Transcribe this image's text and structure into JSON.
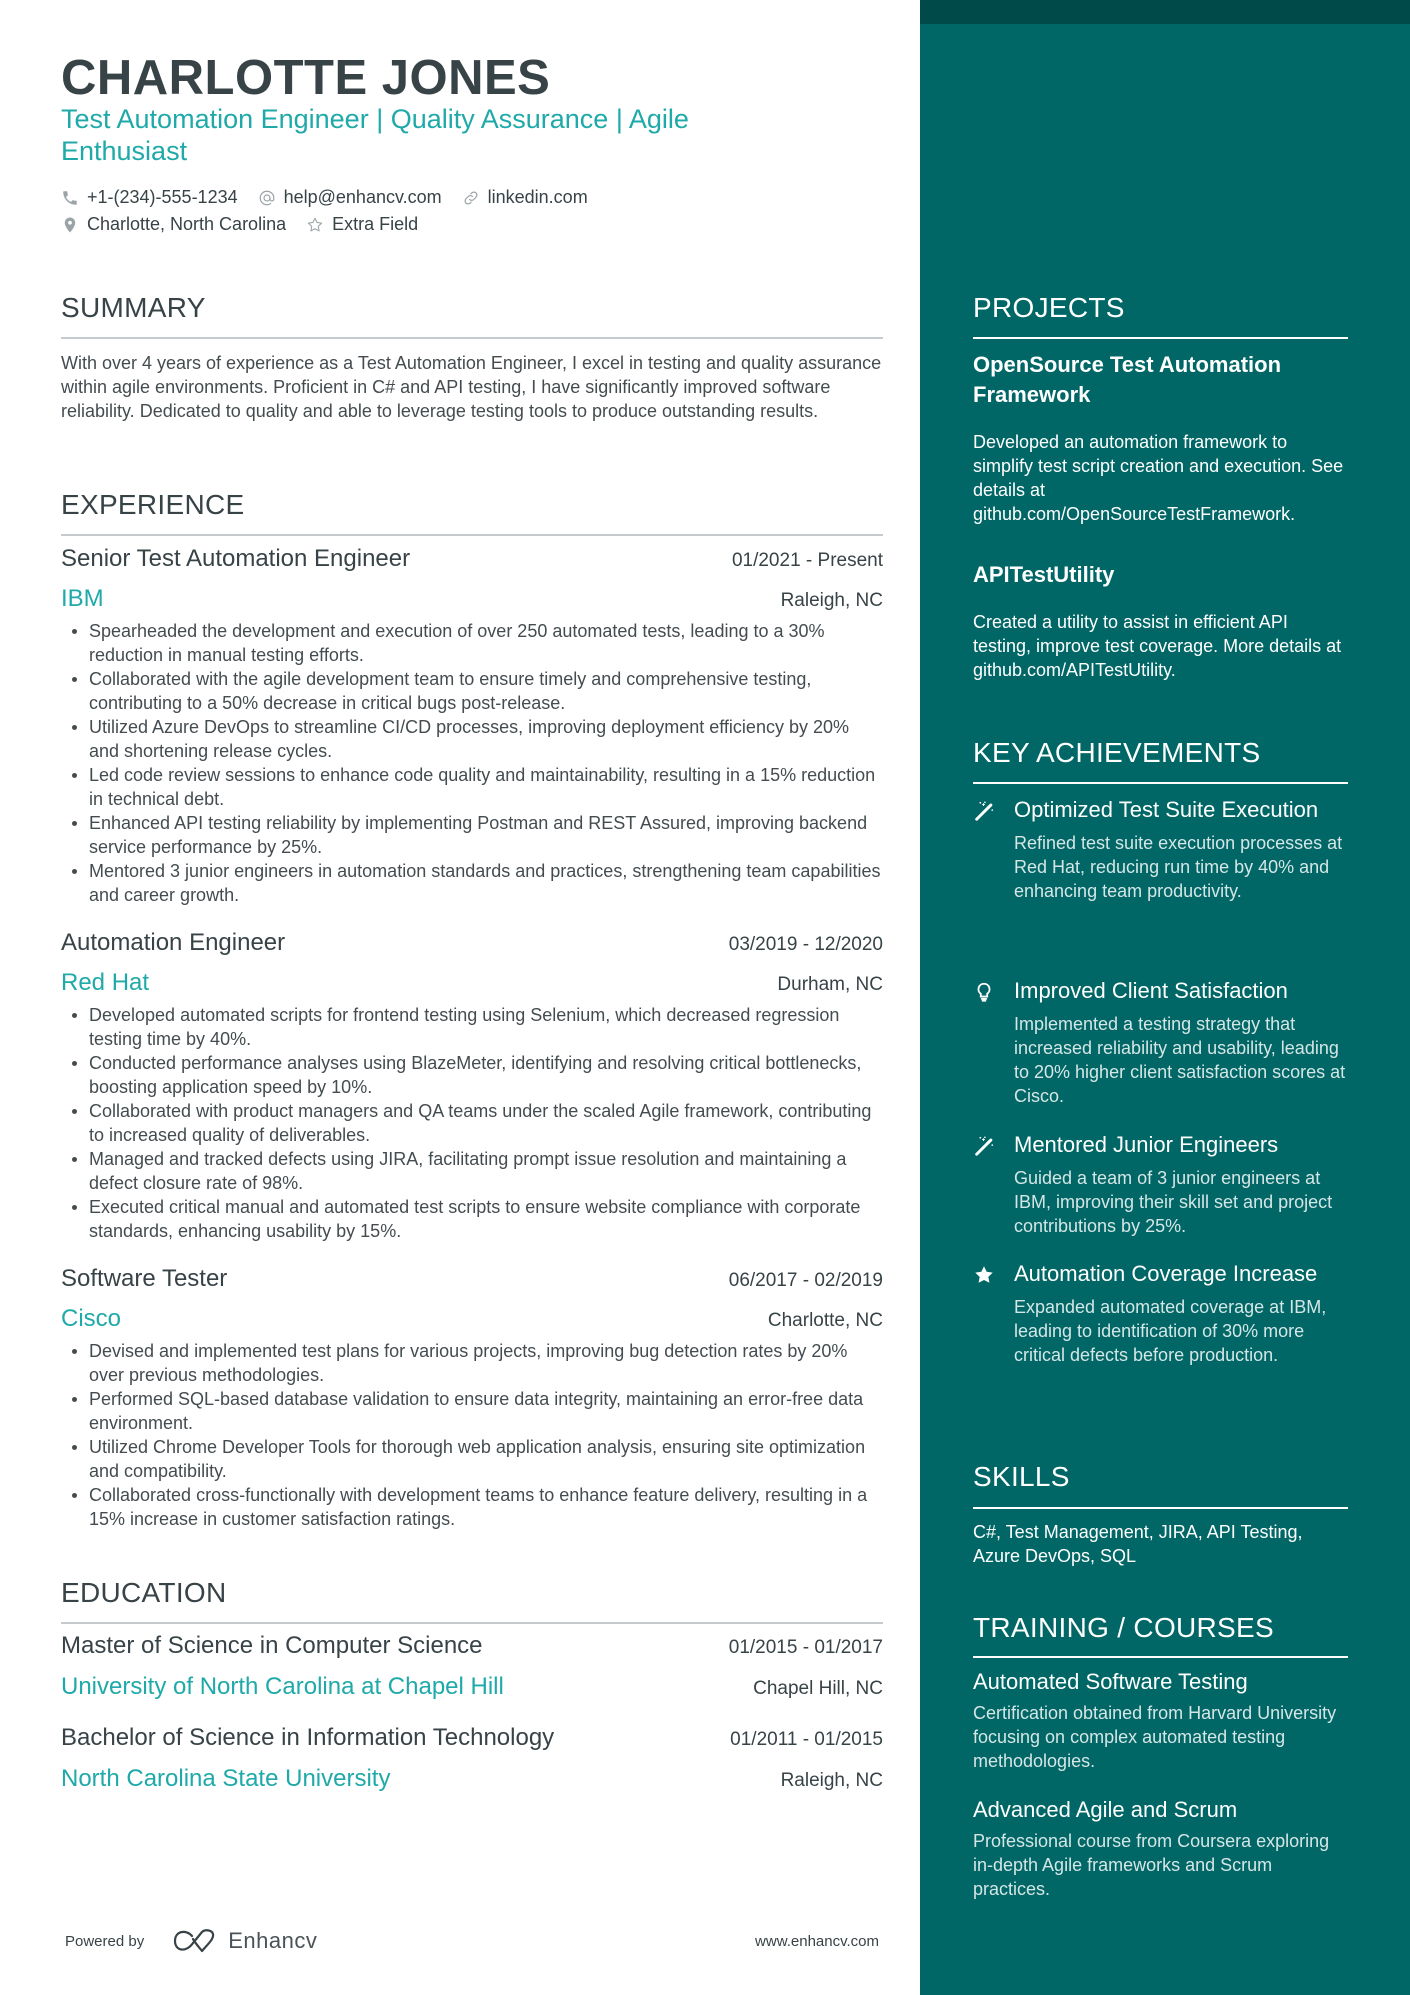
{
  "header": {
    "name": "CHARLOTTE JONES",
    "subtitle": "Test Automation Engineer | Quality Assurance | Agile Enthusiast",
    "contacts": [
      {
        "icon": "phone-icon",
        "text": "+1-(234)-555-1234"
      },
      {
        "icon": "at-icon",
        "text": "help@enhancv.com"
      },
      {
        "icon": "link-icon",
        "text": "linkedin.com"
      },
      {
        "icon": "location-pin-icon",
        "text": "Charlotte, North Carolina"
      },
      {
        "icon": "star-outline-icon",
        "text": "Extra Field"
      }
    ]
  },
  "summary": {
    "title": "SUMMARY",
    "text": "With over 4 years of experience as a Test Automation Engineer, I excel in testing and quality assurance within agile environments. Proficient in C# and API testing, I have significantly improved software reliability. Dedicated to quality and able to leverage testing tools to produce outstanding results."
  },
  "experience": {
    "title": "EXPERIENCE",
    "jobs": [
      {
        "title": "Senior Test Automation Engineer",
        "dates": "01/2021 - Present",
        "company": "IBM",
        "location": "Raleigh, NC",
        "bullets": [
          "Spearheaded the development and execution of over 250 automated tests, leading to a 30% reduction in manual testing efforts.",
          "Collaborated with the agile development team to ensure timely and comprehensive testing, contributing to a 50% decrease in critical bugs post-release.",
          "Utilized Azure DevOps to streamline CI/CD processes, improving deployment efficiency by 20% and shortening release cycles.",
          "Led code review sessions to enhance code quality and maintainability, resulting in a 15% reduction in technical debt.",
          "Enhanced API testing reliability by implementing Postman and REST Assured, improving backend service performance by 25%.",
          "Mentored 3 junior engineers in automation standards and practices, strengthening team capabilities and career growth."
        ]
      },
      {
        "title": "Automation Engineer",
        "dates": "03/2019 - 12/2020",
        "company": "Red Hat",
        "location": "Durham, NC",
        "bullets": [
          "Developed automated scripts for frontend testing using Selenium, which decreased regression testing time by 40%.",
          "Conducted performance analyses using BlazeMeter, identifying and resolving critical bottlenecks, boosting application speed by 10%.",
          "Collaborated with product managers and QA teams under the scaled Agile framework, contributing to increased quality of deliverables.",
          "Managed and tracked defects using JIRA, facilitating prompt issue resolution and maintaining a defect closure rate of 98%.",
          "Executed critical manual and automated test scripts to ensure website compliance with corporate standards, enhancing usability by 15%."
        ]
      },
      {
        "title": "Software Tester",
        "dates": "06/2017 - 02/2019",
        "company": "Cisco",
        "location": "Charlotte, NC",
        "bullets": [
          "Devised and implemented test plans for various projects, improving bug detection rates by 20% over previous methodologies.",
          "Performed SQL-based database validation to ensure data integrity, maintaining an error-free data environment.",
          "Utilized Chrome Developer Tools for thorough web application analysis, ensuring site optimization and compatibility.",
          "Collaborated cross-functionally with development teams to enhance feature delivery, resulting in a 15% increase in customer satisfaction ratings."
        ]
      }
    ]
  },
  "education": {
    "title": "EDUCATION",
    "items": [
      {
        "degree": "Master of Science in Computer Science",
        "dates": "01/2015 - 01/2017",
        "school": "University of North Carolina at Chapel Hill",
        "location": "Chapel Hill, NC"
      },
      {
        "degree": "Bachelor of Science in Information Technology",
        "dates": "01/2011 - 01/2015",
        "school": "North Carolina State University",
        "location": "Raleigh, NC"
      }
    ]
  },
  "footer": {
    "powered_by": "Powered by",
    "brand": "Enhancv",
    "website": "www.enhancv.com"
  },
  "sidebar": {
    "projects": {
      "title": "PROJECTS",
      "items": [
        {
          "title": "OpenSource Test Automation Framework",
          "description": "Developed an automation framework to simplify test script creation and execution. See details at github.com/OpenSourceTestFramework."
        },
        {
          "title": "APITestUtility",
          "description": "Created a utility to assist in efficient API testing, improve test coverage. More details at github.com/APITestUtility."
        }
      ]
    },
    "achievements": {
      "title": "KEY ACHIEVEMENTS",
      "items": [
        {
          "icon": "magic-wand-icon",
          "title": "Optimized Test Suite Execution",
          "description": "Refined test suite execution processes at Red Hat, reducing run time by 40% and enhancing team productivity."
        },
        {
          "icon": "lightbulb-icon",
          "title": "Improved Client Satisfaction",
          "description": "Implemented a testing strategy that increased reliability and usability, leading to 20% higher client satisfaction scores at Cisco."
        },
        {
          "icon": "magic-wand-icon",
          "title": "Mentored Junior Engineers",
          "description": "Guided a team of 3 junior engineers at IBM, improving their skill set and project contributions by 25%."
        },
        {
          "icon": "star-icon",
          "title": "Automation Coverage Increase",
          "description": "Expanded automated coverage at IBM, leading to identification of 30% more critical defects before production."
        }
      ]
    },
    "skills": {
      "title": "SKILLS",
      "text": "C#, Test Management, JIRA, API Testing, Azure DevOps, SQL"
    },
    "training": {
      "title": "TRAINING / COURSES",
      "items": [
        {
          "title": "Automated Software Testing",
          "description": "Certification obtained from Harvard University focusing on complex automated testing methodologies."
        },
        {
          "title": "Advanced Agile and Scrum",
          "description": "Professional course from Coursera exploring in-depth Agile frameworks and Scrum practices."
        }
      ]
    }
  },
  "colors": {
    "accent": "#1fa9a9",
    "sidebar": "#006766",
    "sidebar_top": "#004a4a",
    "text": "#384347"
  }
}
